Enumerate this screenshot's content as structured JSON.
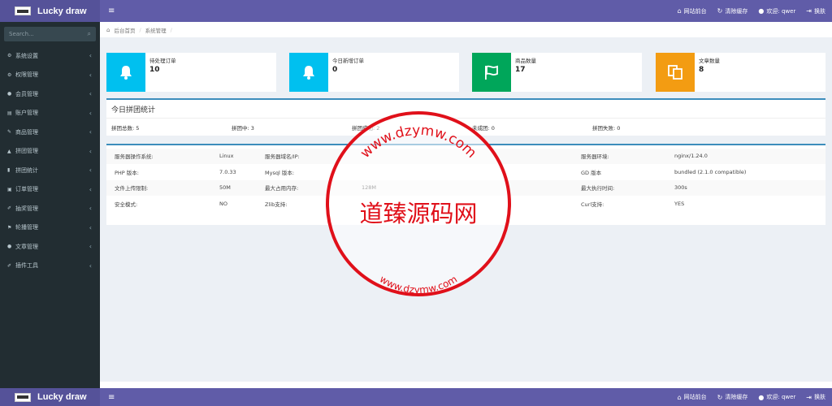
{
  "app": {
    "title": "Lucky draw"
  },
  "topbar": {
    "toggle_icon": "menu-icon",
    "links": [
      {
        "icon": "home-icon",
        "label": "网站前台"
      },
      {
        "icon": "refresh-icon",
        "label": "清除缓存"
      },
      {
        "icon": "user-icon",
        "label": "欢迎: qwer"
      },
      {
        "icon": "signout-icon",
        "label": "换肤"
      }
    ]
  },
  "sidebar": {
    "search_placeholder": "Search...",
    "items": [
      {
        "icon": "gear-icon",
        "glyph": "⚙",
        "label": "系统设置"
      },
      {
        "icon": "gears-icon",
        "glyph": "⚙",
        "label": "权限管理"
      },
      {
        "icon": "user-icon",
        "glyph": "●",
        "label": "会员管理"
      },
      {
        "icon": "file-icon",
        "glyph": "▤",
        "label": "账户管理"
      },
      {
        "icon": "edit-icon",
        "glyph": "✎",
        "label": "商品管理"
      },
      {
        "icon": "bell-icon",
        "glyph": "▲",
        "label": "拼团管理"
      },
      {
        "icon": "bar-chart-icon",
        "glyph": "▮",
        "label": "拼团统计"
      },
      {
        "icon": "ticket-icon",
        "glyph": "▣",
        "label": "订单管理"
      },
      {
        "icon": "gavel-icon",
        "glyph": "✐",
        "label": "抽奖管理"
      },
      {
        "icon": "flag-icon",
        "glyph": "⚑",
        "label": "轮播管理"
      },
      {
        "icon": "comments-icon",
        "glyph": "●",
        "label": "文章管理"
      },
      {
        "icon": "plug-icon",
        "glyph": "✐",
        "label": "插件工具"
      }
    ]
  },
  "breadcrumb": {
    "home": "后台首页",
    "current": "系统管理"
  },
  "stats": [
    {
      "icon": "bell-icon",
      "color": "#00c0ef",
      "label": "待处理订单",
      "value": "10"
    },
    {
      "icon": "bell-icon",
      "color": "#00c0ef",
      "label": "今日新增订单",
      "value": "0"
    },
    {
      "icon": "flag-icon",
      "color": "#00a65a",
      "label": "商品数量",
      "value": "17"
    },
    {
      "icon": "files-icon",
      "color": "#f39c12",
      "label": "文章数量",
      "value": "8"
    }
  ],
  "group_stats": {
    "title": "今日拼团统计",
    "items": [
      {
        "label": "拼团总数:",
        "value": "5"
      },
      {
        "label": "拼团中:",
        "value": "3"
      },
      {
        "label": "拼团成功:",
        "value": "2"
      },
      {
        "label": "未成团:",
        "value": "0"
      },
      {
        "label": "拼团失败:",
        "value": "0"
      }
    ]
  },
  "server_info": [
    [
      "服务器操作系统:",
      "Linux",
      "服务器域名/IP:",
      "",
      "服务器环境:",
      "nginx/1.24.0"
    ],
    [
      "PHP 版本:",
      "7.0.33",
      "Mysql 版本:",
      "",
      "GD 版本",
      "bundled (2.1.0 compatible)"
    ],
    [
      "文件上传限制:",
      "50M",
      "最大占用内存:",
      "128M",
      "最大执行时间:",
      "300s"
    ],
    [
      "安全模式:",
      "NO",
      "Zlib支持:",
      "",
      "Curl支持:",
      "YES"
    ]
  ],
  "watermark": {
    "color": "#e0101a",
    "center_text": "道臻源码网",
    "top_text": "www.dzymw.com",
    "bottom_text": "www.dzymw.com"
  }
}
